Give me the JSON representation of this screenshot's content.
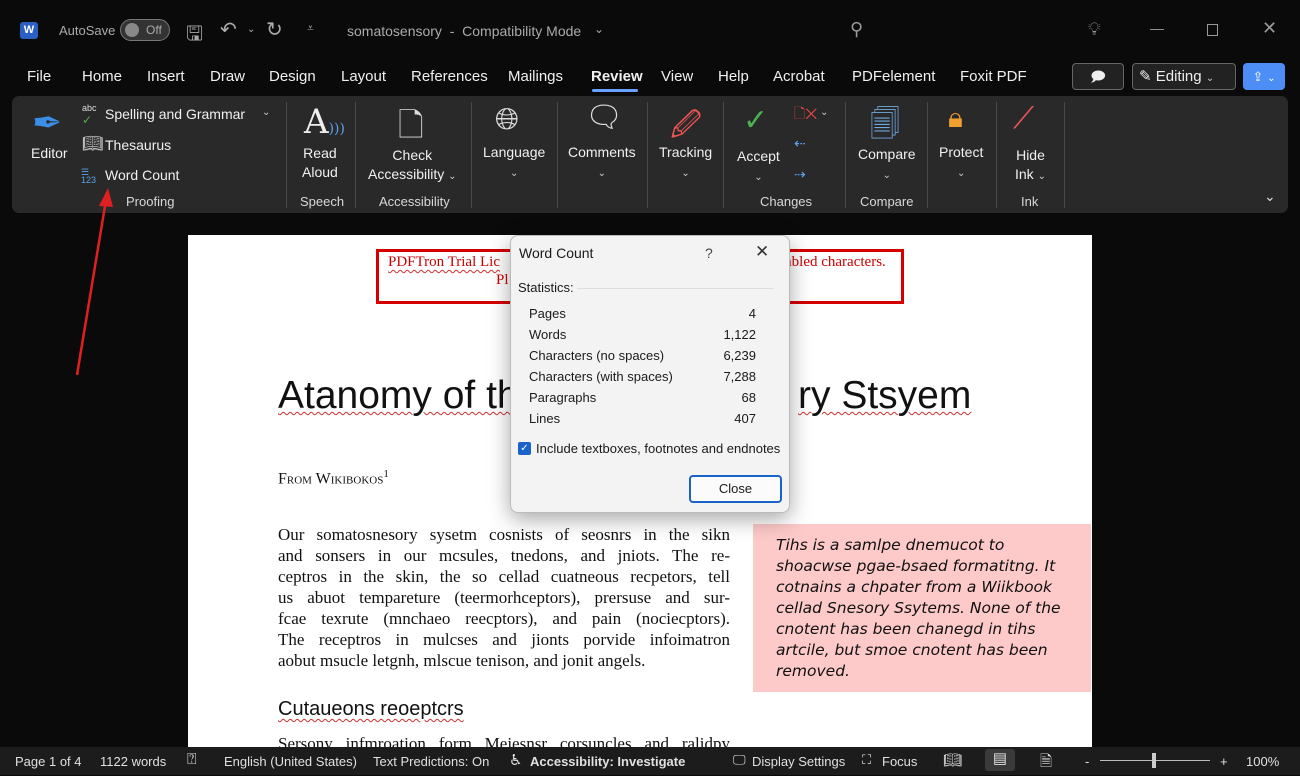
{
  "titlebar": {
    "app_icon": "word-icon",
    "autosave_label": "AutoSave",
    "autosave_state": "Off",
    "doc_title": "somatosensory  -  Compatibility Mode",
    "icons": [
      "save-icon",
      "undo-icon",
      "redo-icon",
      "customize-icon",
      "search-icon",
      "lightbulb-icon",
      "minimize-icon",
      "maximize-icon",
      "close-icon"
    ]
  },
  "menu_tabs": [
    "File",
    "Home",
    "Insert",
    "Draw",
    "Design",
    "Layout",
    "References",
    "Mailings",
    "Review",
    "View",
    "Help",
    "Acrobat",
    "PDFelement",
    "Foxit PDF"
  ],
  "active_tab": "Review",
  "header_buttons": {
    "editing": "Editing",
    "comment_icon": "comment-icon",
    "share_icon": "share-icon",
    "accent": "#4c8df6"
  },
  "ribbon": {
    "editor": "Editor",
    "spelling": "Spelling and Grammar",
    "thesaurus": "Thesaurus",
    "word_count": "Word Count",
    "proofing": "Proofing",
    "read": "Read",
    "aloud": "Aloud",
    "speech": "Speech",
    "check": "Check",
    "accessibility_btn": "Accessibility",
    "accessibility_group": "Accessibility",
    "language": "Language",
    "comments": "Comments",
    "tracking": "Tracking",
    "accept": "Accept",
    "changes": "Changes",
    "compare_btn": "Compare",
    "compare_group": "Compare",
    "protect": "Protect",
    "hide": "Hide",
    "ink_btn": "Ink",
    "ink_group": "Ink"
  },
  "document": {
    "watermark_left": "PDFTron Trial Lic",
    "watermark_right": "mbled characters.",
    "watermark_line2": "Pl",
    "title_left": "Atanomy of th",
    "title_right": "ry Stsyem",
    "byline": "From Wikibokos",
    "byline_sup": "1",
    "paragraph": [
      "Our somatosnesory sysetm cosnists of seosnrs in the sikn",
      "and sonsers in our mcsules, tnedons, and jniots. The re-",
      "ceptros in the skin, the so cellad cuatneous recpetors, tell",
      "us abuot tempareture (teermorhceptors), prersuse and sur-",
      "fcae texrute (mnchaeo reecptors), and pain (nociecptors).",
      "The receptros in mulcses and jionts porvide infoimatron",
      "aobut msucle letgnh, mlscue tenison, and jonit angels."
    ],
    "heading2": "Cutaueons reoeptcrs",
    "next_line": "Sersony infmroation form Meiesnsr corsuncles and ralidpy",
    "note": [
      "Tihs is a samlpe dnemucot to",
      "shoacwse pgae-bsaed formatitng. It",
      "cotnains a chpater from a Wiikbook",
      "cellad Snesory Ssytems. None of the",
      "cnotent has been chanegd in tihs",
      "artcile, but smoe cnotent has been",
      "removed."
    ],
    "note_bg": "#fdc9c9"
  },
  "dialog": {
    "title": "Word Count",
    "help": "?",
    "section": "Statistics:",
    "stats": [
      {
        "label": "Pages",
        "value": "4"
      },
      {
        "label": "Words",
        "value": "1,122"
      },
      {
        "label": "Characters (no spaces)",
        "value": "6,239"
      },
      {
        "label": "Characters (with spaces)",
        "value": "7,288"
      },
      {
        "label": "Paragraphs",
        "value": "68"
      },
      {
        "label": "Lines",
        "value": "407"
      }
    ],
    "checkbox_label": "Include textboxes, footnotes and endnotes",
    "checkbox_checked": true,
    "close": "Close"
  },
  "statusbar": {
    "page": "Page 1 of 4",
    "words": "1122 words",
    "language": "English (United States)",
    "predictions": "Text Predictions: On",
    "accessibility": "Accessibility: Investigate",
    "display": "Display Settings",
    "focus": "Focus",
    "zoom": "100%",
    "zoom_minus": "-",
    "zoom_plus": "+"
  },
  "annotation_color": "#e02020"
}
